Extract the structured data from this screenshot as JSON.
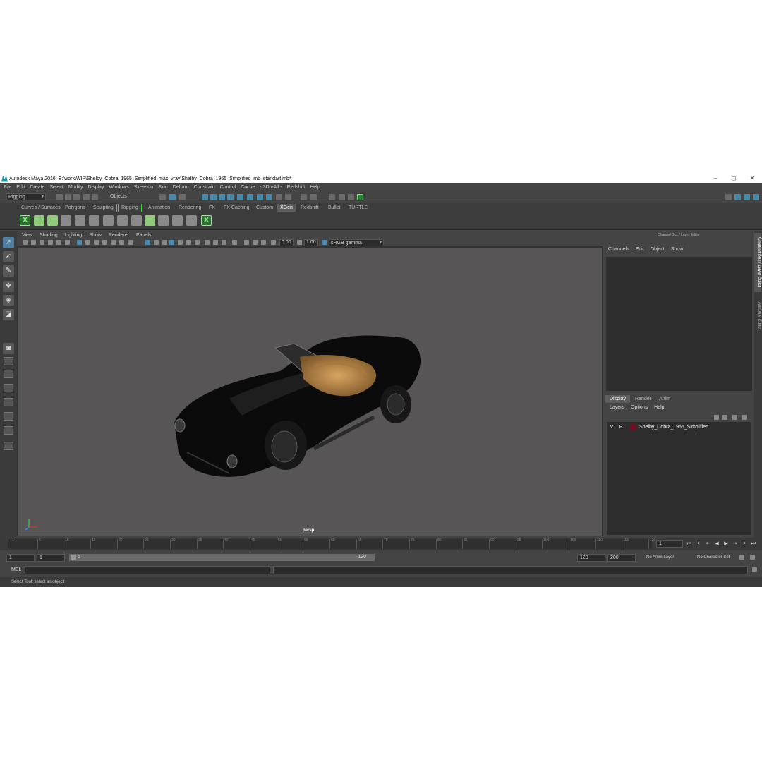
{
  "window": {
    "title": "Autodesk Maya 2016: E:\\work\\WIP\\Shelby_Cobra_1965_Simplified_max_vray\\Shelby_Cobra_1965_Simplified_mb_standart.mb*",
    "minimize": "–",
    "maximize": "◻",
    "close": "✕"
  },
  "menu": [
    "File",
    "Edit",
    "Create",
    "Select",
    "Modify",
    "Display",
    "Windows",
    "Skeleton",
    "Skin",
    "Deform",
    "Constrain",
    "Control",
    "Cache",
    "- 3DtoAll -",
    "Redshift",
    "Help"
  ],
  "statusline": {
    "menuset": "Rigging",
    "objects_label": "Objects"
  },
  "shelf_tabs": [
    "Curves / Surfaces",
    "Polygons",
    "Sculpting",
    "Rigging",
    "Animation",
    "Rendering",
    "FX",
    "FX Caching",
    "Custom",
    "XGen",
    "Redshift",
    "Bullet",
    "TURTLE"
  ],
  "active_shelf_tab": "XGen",
  "viewport": {
    "menu": [
      "View",
      "Shading",
      "Lighting",
      "Show",
      "Renderer",
      "Panels"
    ],
    "exposure": "0.00",
    "gamma": "1.00",
    "colorspace": "sRGB gamma",
    "camera": "persp"
  },
  "channel_box": {
    "title": "Channel Box / Layer Editor",
    "menu": [
      "Channels",
      "Edit",
      "Object",
      "Show"
    ]
  },
  "layer_editor": {
    "tabs": [
      "Display",
      "Render",
      "Anim"
    ],
    "menu": [
      "Layers",
      "Options",
      "Help"
    ],
    "layer": {
      "v": "V",
      "p": "P",
      "name": "Shelby_Cobra_1965_Simplified"
    }
  },
  "side_tabs": [
    "Channel Box / Layer Editor",
    "Attribute Editor"
  ],
  "timeline": {
    "ticks": [
      "1",
      "5",
      "10",
      "15",
      "20",
      "25",
      "30",
      "35",
      "40",
      "45",
      "50",
      "55",
      "60",
      "65",
      "70",
      "75",
      "80",
      "85",
      "90",
      "95",
      "100",
      "105",
      "110",
      "115",
      "120"
    ],
    "current_frame": "1"
  },
  "range": {
    "start": "1",
    "playback_start": "1",
    "slider_start": "1",
    "slider_end": "120",
    "playback_end": "120",
    "end": "200",
    "anim_layer": "No Anim Layer",
    "char_set": "No Character Set"
  },
  "command": {
    "lang": "MEL"
  },
  "status": "Select Tool: select an object",
  "colors": {
    "accent": "#4f7fa3",
    "layer": "#7a0a1c",
    "viewport_bg": "#575556"
  }
}
